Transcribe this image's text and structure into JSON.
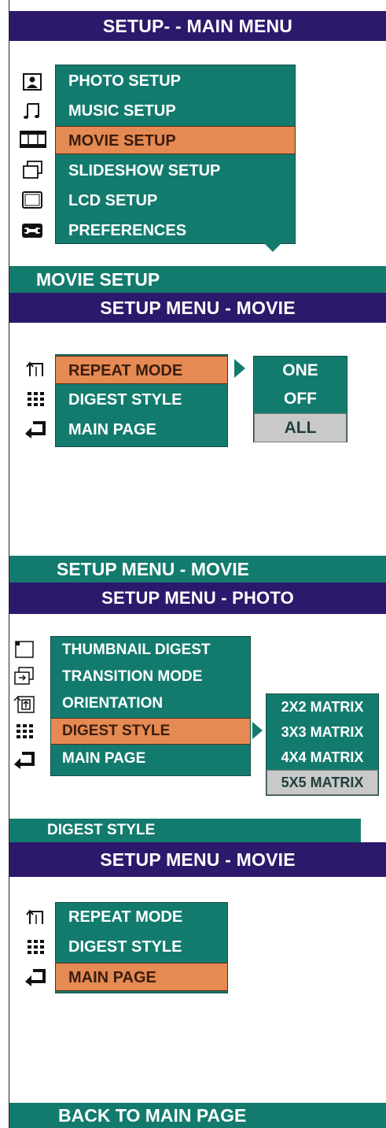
{
  "panel1": {
    "title": "SETUP- - MAIN MENU",
    "items": [
      {
        "label": "PHOTO SETUP",
        "icon": "photo-icon"
      },
      {
        "label": "MUSIC SETUP",
        "icon": "music-note-icon"
      },
      {
        "label": "MOVIE SETUP",
        "icon": "film-strip-icon",
        "selected": true
      },
      {
        "label": "SLIDESHOW SETUP",
        "icon": "slideshow-icon"
      },
      {
        "label": "LCD SETUP",
        "icon": "lcd-screen-icon"
      },
      {
        "label": "PREFERENCES",
        "icon": "wrench-icon"
      }
    ],
    "footer": "MOVIE SETUP"
  },
  "panel2": {
    "title": "SETUP MENU -  MOVIE",
    "items": [
      {
        "label": "REPEAT MODE",
        "icon": "repeat-icon",
        "selected": true
      },
      {
        "label": "DIGEST STYLE",
        "icon": "grid-dots-icon"
      },
      {
        "label": "MAIN PAGE",
        "icon": "return-arrow-icon"
      }
    ],
    "options": [
      "ONE",
      "OFF",
      "ALL"
    ],
    "footer": "SETUP MENU - MOVIE"
  },
  "panel3": {
    "title": "SETUP MENU - PHOTO",
    "items": [
      {
        "label": "THUMBNAIL DIGEST",
        "icon": "thumbnail-icon"
      },
      {
        "label": "TRANSITION MODE",
        "icon": "transition-icon"
      },
      {
        "label": "ORIENTATION",
        "icon": "orientation-icon"
      },
      {
        "label": "DIGEST STYLE",
        "icon": "grid-dots-icon",
        "selected": true
      },
      {
        "label": "MAIN PAGE",
        "icon": "return-arrow-icon"
      }
    ],
    "options": [
      "2X2 MATRIX",
      "3X3 MATRIX",
      "4X4 MATRIX",
      "5X5 MATRIX"
    ],
    "footer": "DIGEST STYLE"
  },
  "panel4": {
    "title": "SETUP MENU -  MOVIE",
    "items": [
      {
        "label": "REPEAT MODE",
        "icon": "repeat-icon"
      },
      {
        "label": "DIGEST STYLE",
        "icon": "grid-dots-icon"
      },
      {
        "label": "MAIN PAGE",
        "icon": "return-arrow-icon",
        "selected": true
      }
    ],
    "footer": "BACK TO MAIN PAGE"
  },
  "colors": {
    "header": "#2c196c",
    "menu": "#137b6e",
    "selected": "#e58a52",
    "disabled": "#c9c9c9"
  }
}
